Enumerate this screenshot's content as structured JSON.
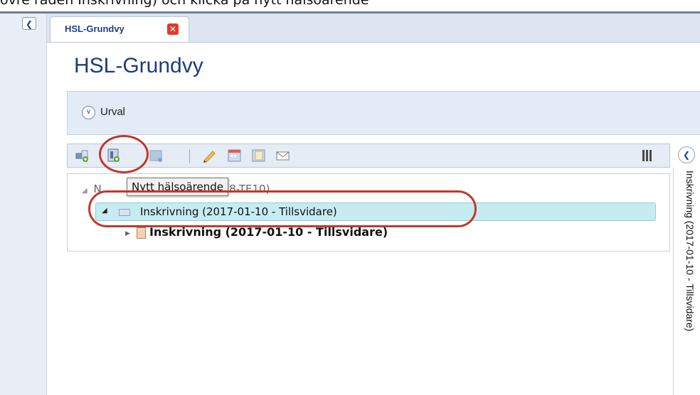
{
  "caption": "övre raden Inskrivning) och klicka på nytt hälsoärende",
  "tab": {
    "label": "HSL-Grundvy",
    "close_label": "✕"
  },
  "page": {
    "title": "HSL-Grundvy"
  },
  "urval": {
    "label": "Urval"
  },
  "toolbar": {
    "items": [
      "add-icon",
      "new-case-icon",
      "document-icon",
      "pencil-icon",
      "calendar-icon",
      "notes-icon",
      "mail-icon",
      "columns-icon"
    ]
  },
  "tooltip": {
    "text": "Nytt hälsoärende"
  },
  "tree": {
    "row0": "N",
    "row0_tail": "8-TE10)",
    "row1": "Inskrivning (2017-01-10 - Tillsvidare)",
    "row2": "Inskrivning (2017-01-10 - Tillsvidare)"
  },
  "side_panel": {
    "label": "Inskrivning (2017-01-10 - Tillsvidare)"
  },
  "colors": {
    "accent": "#1e3c7a",
    "highlight": "#c6ecf2",
    "annotation": "#c0392b"
  }
}
